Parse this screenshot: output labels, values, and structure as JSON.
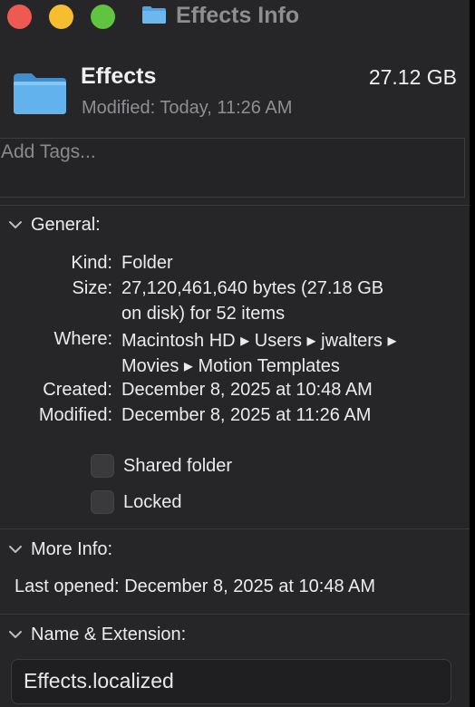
{
  "window": {
    "title": "Effects Info"
  },
  "header": {
    "name": "Effects",
    "size": "27.12 GB",
    "modified": "Modified: Today, 11:26 AM"
  },
  "tags": {
    "placeholder": "Add Tags..."
  },
  "general": {
    "label": "General:",
    "kind_label": "Kind:",
    "kind_value": "Folder",
    "size_label": "Size:",
    "size_line1": "27,120,461,640 bytes (27.18 GB",
    "size_line2": "on disk) for 52 items",
    "where_label": "Where:",
    "where_line1": "Macintosh HD ▸ Users ▸ jwalters ▸",
    "where_line2": "Movies ▸ Motion Templates",
    "created_label": "Created:",
    "created_value": "December 8, 2025 at 10:48 AM",
    "modified_label": "Modified:",
    "modified_value": "December 8, 2025 at 11:26 AM",
    "shared_folder_label": "Shared folder",
    "shared_folder_checked": false,
    "locked_label": "Locked",
    "locked_checked": false
  },
  "more_info": {
    "label": "More Info:",
    "last_opened": "Last opened: December 8, 2025 at 10:48 AM"
  },
  "name_extension": {
    "label": "Name & Extension:",
    "value": "Effects.localized"
  },
  "icons": {
    "close": "close-icon",
    "minimize": "minimize-icon",
    "zoom": "zoom-icon",
    "folder": "folder-icon",
    "chevron": "chevron-down-icon"
  },
  "colors": {
    "close": "#ee5a52",
    "minimize": "#f5bd2f",
    "zoom": "#5fc43f",
    "folder": "#5aaee8"
  }
}
